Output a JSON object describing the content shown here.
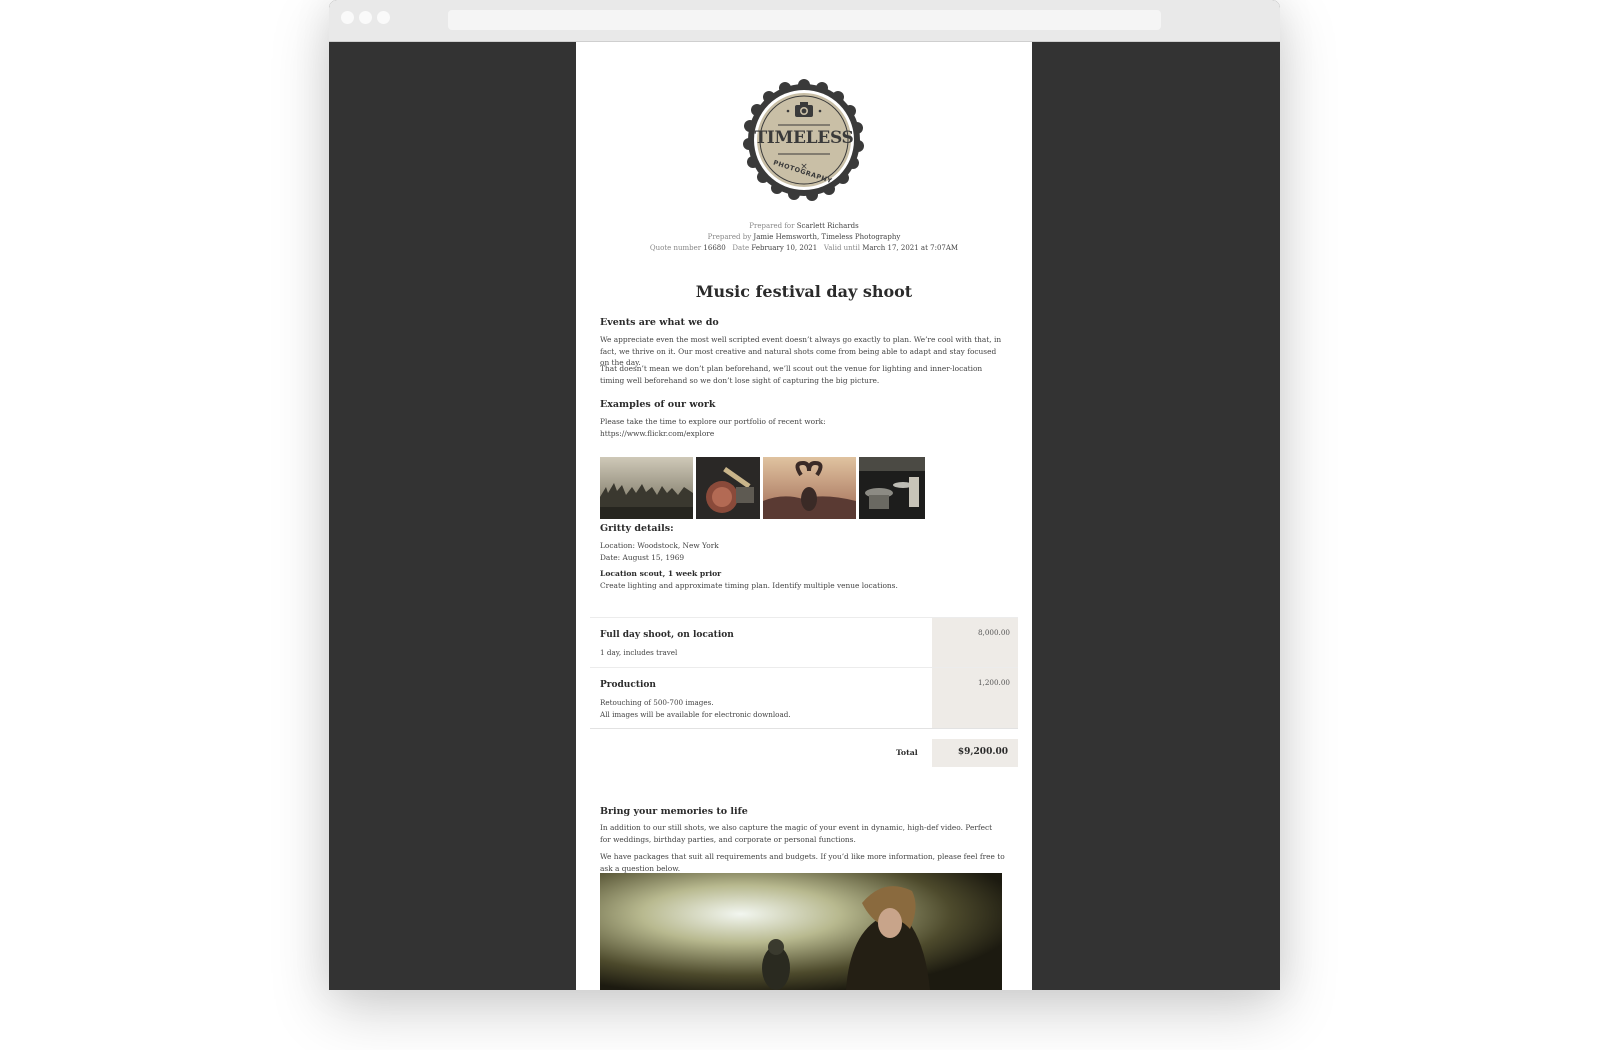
{
  "browser": {
    "window_buttons": [
      "close",
      "minimize",
      "maximize"
    ],
    "address_bar": ""
  },
  "logo": {
    "name": "TIMELESS",
    "sub": "PHOTOGRAPHY",
    "icon": "camera-icon",
    "colors": {
      "ring": "#3a3a3a",
      "fill": "#c9bfa6"
    }
  },
  "meta": {
    "prepared_for_label": "Prepared for",
    "prepared_for": "Scarlett Richards",
    "prepared_by_label": "Prepared by",
    "prepared_by": "Jamie Hemsworth, Timeless Photography",
    "quote_number_label": "Quote number",
    "quote_number": "16680",
    "date_label": "Date",
    "date": "February 10, 2021",
    "valid_until_label": "Valid until",
    "valid_until": "March 17, 2021 at 7:07AM"
  },
  "quote": {
    "title": "Music festival day shoot",
    "sections": {
      "events": {
        "heading": "Events are what we do",
        "p1": "We appreciate even the most well scripted event doesn’t always go exactly to plan. We’re cool with that, in fact, we thrive on it. Our most creative and natural shots come from being able to adapt and stay focused on the day.",
        "p2": "That doesn’t mean we don’t plan beforehand, we’ll scout out the venue for lighting and inner-location timing well beforehand so we don’t lose sight of capturing the big picture."
      },
      "examples": {
        "heading": "Examples of our work",
        "text": "Please take the time to explore our portfolio of recent work:",
        "link": "https://www.flickr.com/explore"
      },
      "gritty": {
        "heading": "Gritty details:",
        "location": "Location: Woodstock, New York",
        "date": "Date: August 15, 1969",
        "scout_title": "Location scout, 1 week prior",
        "scout_desc": "Create lighting and approximate timing plan. Identify multiple venue locations."
      },
      "memories": {
        "heading": "Bring your memories to life",
        "p1": "In addition to our still shots, we also capture the magic of your event in dynamic, high-def video. Perfect for weddings, birthday parties, and corporate or personal functions.",
        "p2": "We have packages that suit all requirements and budgets. If you’d like more information, please feel free to ask a question below."
      }
    },
    "line_items": [
      {
        "title": "Full day shoot, on location",
        "desc": "1 day, includes travel",
        "price": "8,000.00"
      },
      {
        "title": "Production",
        "desc1": "Retouching of 500-700 images.",
        "desc2": "All images will be available for electronic download.",
        "price": "1,200.00"
      }
    ],
    "total_label": "Total",
    "total": "$9,200.00"
  }
}
